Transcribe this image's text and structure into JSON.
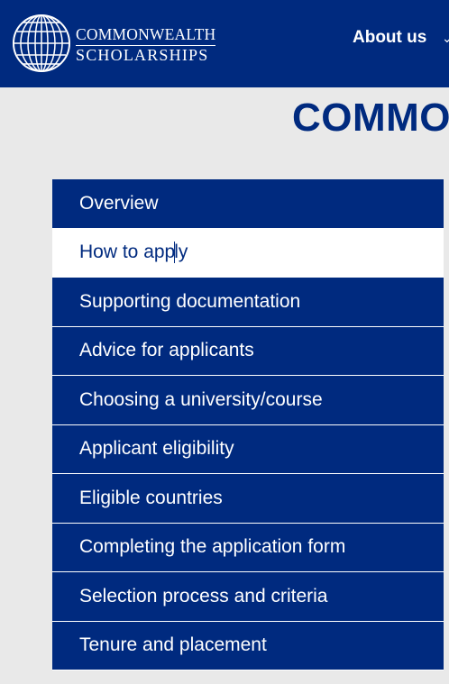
{
  "header": {
    "logo_line1": "COMMONWEALTH",
    "logo_line2": "SCHOLARSHIPS",
    "nav_about_label": "About us",
    "nav_about_icon": "chevron-down-icon"
  },
  "page": {
    "title": "COMMO"
  },
  "colors": {
    "brand_navy": "#002a7f",
    "page_bg": "#e9e9e9",
    "active_bg": "#ffffff"
  },
  "menu": {
    "items": [
      {
        "label": "Overview",
        "active": false
      },
      {
        "label_part1": "How to app",
        "label_part2": "ly",
        "active": true
      },
      {
        "label": "Supporting documentation",
        "active": false
      },
      {
        "label": "Advice for applicants",
        "active": false
      },
      {
        "label": "Choosing a university/course",
        "active": false
      },
      {
        "label": "Applicant eligibility",
        "active": false
      },
      {
        "label": "Eligible countries",
        "active": false
      },
      {
        "label": "Completing the application form",
        "active": false
      },
      {
        "label": "Selection process and criteria",
        "active": false
      },
      {
        "label": "Tenure and placement",
        "active": false
      }
    ]
  }
}
